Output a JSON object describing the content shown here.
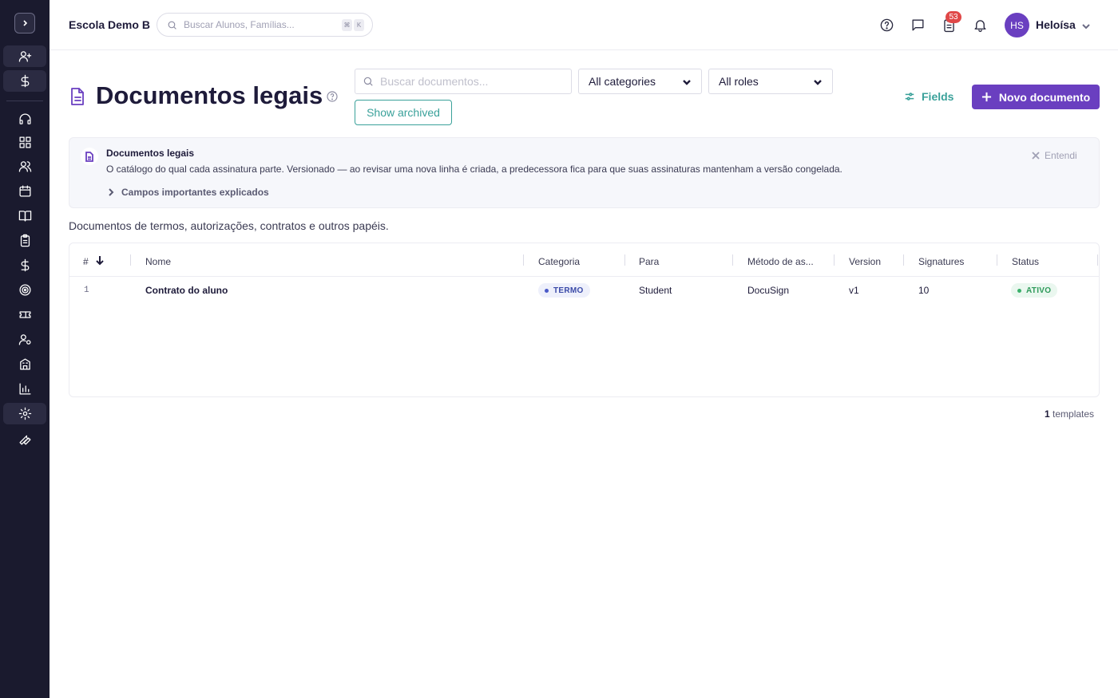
{
  "header": {
    "school_name": "Escola Demo B",
    "global_search_placeholder": "Buscar Alunos, Famílias...",
    "kbd_keys": [
      "⌘",
      "K"
    ],
    "notifications_badge": "53",
    "user_initials": "HS",
    "user_name": "Heloísa"
  },
  "sidebar": {
    "items": [
      "add-user-icon",
      "dollar-icon",
      "headset-icon",
      "grid-icon",
      "users-icon",
      "calendar-icon",
      "book-icon",
      "clipboard-icon",
      "dollar-icon",
      "target-icon",
      "ticket-icon",
      "user-settings-icon",
      "building-icon",
      "bar-chart-icon",
      "gear-icon",
      "wrench-icon"
    ]
  },
  "page": {
    "title": "Documentos legais",
    "search_placeholder": "Buscar documentos...",
    "category_select": "All categories",
    "role_select": "All roles",
    "show_archived": "Show archived",
    "fields_label": "Fields",
    "new_button": "Novo documento",
    "subtitle": "Documentos de termos, autorizações, contratos e outros papéis."
  },
  "info": {
    "title": "Documentos legais",
    "text": "O catálogo do qual cada assinatura parte. Versionado — ao revisar uma nova linha é criada, a predecessora fica para que suas assinaturas mantenham a versão congelada.",
    "dismiss": "Entendi",
    "expand": "Campos importantes explicados"
  },
  "table": {
    "headers": [
      "#",
      "Nome",
      "Categoria",
      "Para",
      "Método de as...",
      "Version",
      "Signatures",
      "Status"
    ],
    "rows": [
      {
        "num": "1",
        "nome": "Contrato do aluno",
        "categoria": "TERMO",
        "para": "Student",
        "metodo": "DocuSign",
        "version": "v1",
        "signatures": "10",
        "status": "ATIVO"
      }
    ],
    "count": "1",
    "count_label": "templates"
  },
  "colors": {
    "accent": "#6a3fc0",
    "teal": "#3aa19a",
    "sidebar": "#1a1a2e",
    "badge": "#e04848"
  }
}
